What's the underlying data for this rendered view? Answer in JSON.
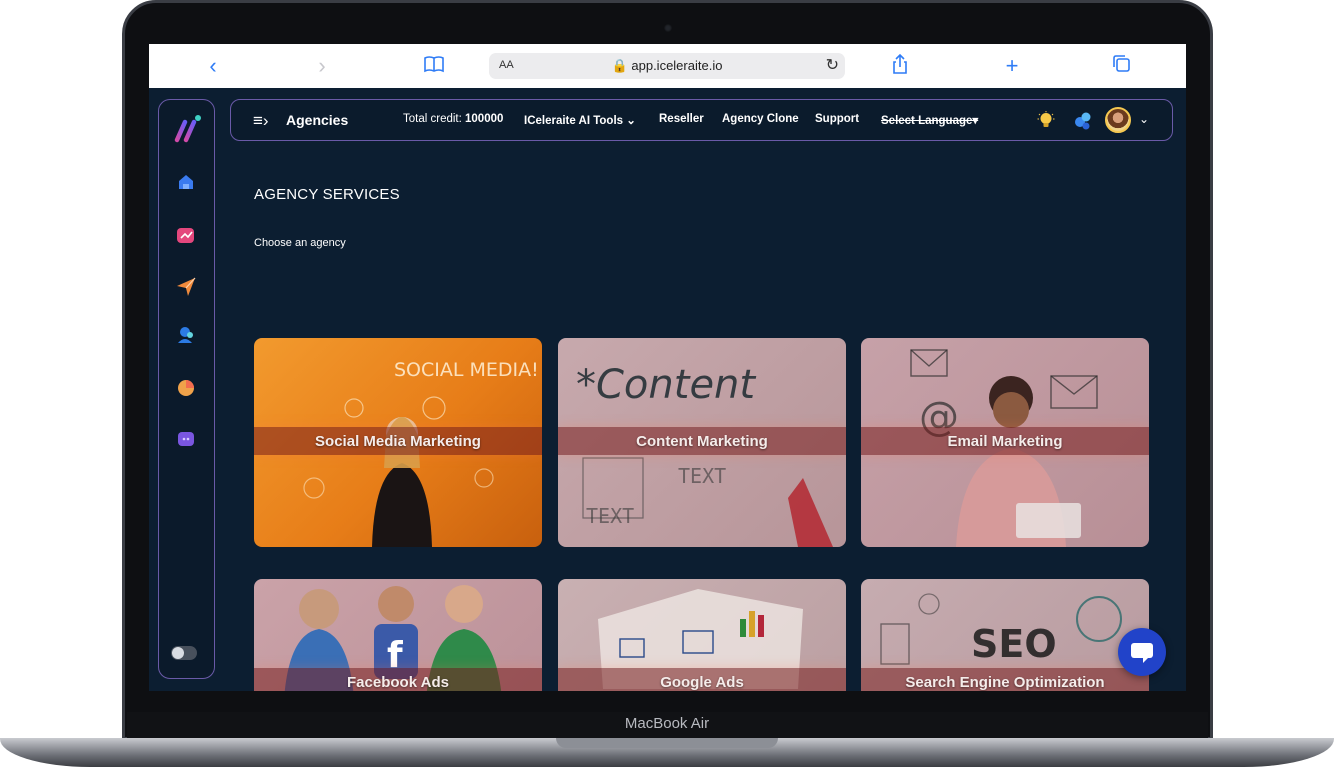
{
  "device": {
    "label": "MacBook Air"
  },
  "browser": {
    "url_prefix": "AA",
    "url": "app.iceleraite.io"
  },
  "header": {
    "title": "Agencies",
    "credit_label": "Total credit:",
    "credit_value": "100000",
    "nav": [
      "ICeleraite AI Tools",
      "Reseller",
      "Agency Clone",
      "Support"
    ],
    "language": "Select Language▾"
  },
  "page": {
    "heading": "AGENCY SERVICES",
    "subheading": "Choose an agency"
  },
  "cards": [
    {
      "label": "Social Media Marketing"
    },
    {
      "label": "Content Marketing"
    },
    {
      "label": "Email Marketing"
    },
    {
      "label": "Facebook Ads"
    },
    {
      "label": "Google Ads"
    },
    {
      "label": "Search Engine Optimization"
    }
  ],
  "colors": {
    "accent": "#6a5aa8",
    "background": "#0c1e31",
    "chat": "#2143c9"
  }
}
